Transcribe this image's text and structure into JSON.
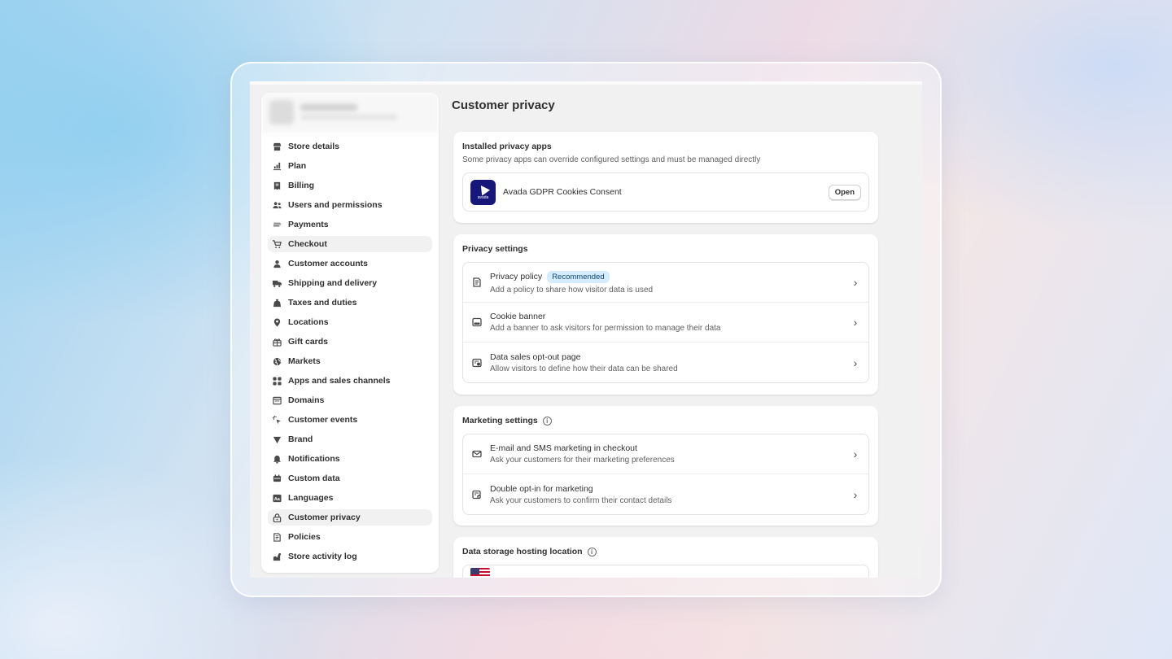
{
  "page": {
    "title": "Customer privacy"
  },
  "sidebar": {
    "items": [
      {
        "label": "Store details",
        "icon": "store-icon",
        "active": false
      },
      {
        "label": "Plan",
        "icon": "chart-icon",
        "active": false
      },
      {
        "label": "Billing",
        "icon": "receipt-icon",
        "active": false
      },
      {
        "label": "Users and permissions",
        "icon": "users-icon",
        "active": false
      },
      {
        "label": "Payments",
        "icon": "payments-icon",
        "active": false
      },
      {
        "label": "Checkout",
        "icon": "cart-icon",
        "active": true
      },
      {
        "label": "Customer accounts",
        "icon": "person-icon",
        "active": false
      },
      {
        "label": "Shipping and delivery",
        "icon": "truck-icon",
        "active": false
      },
      {
        "label": "Taxes and duties",
        "icon": "tax-icon",
        "active": false
      },
      {
        "label": "Locations",
        "icon": "location-icon",
        "active": false
      },
      {
        "label": "Gift cards",
        "icon": "gift-icon",
        "active": false
      },
      {
        "label": "Markets",
        "icon": "globe-icon",
        "active": false
      },
      {
        "label": "Apps and sales channels",
        "icon": "apps-icon",
        "active": false
      },
      {
        "label": "Domains",
        "icon": "domain-icon",
        "active": false
      },
      {
        "label": "Customer events",
        "icon": "cursor-icon",
        "active": false
      },
      {
        "label": "Brand",
        "icon": "brand-icon",
        "active": false
      },
      {
        "label": "Notifications",
        "icon": "bell-icon",
        "active": false
      },
      {
        "label": "Custom data",
        "icon": "database-icon",
        "active": false
      },
      {
        "label": "Languages",
        "icon": "language-icon",
        "active": false
      },
      {
        "label": "Customer privacy",
        "icon": "lock-icon",
        "active": true
      },
      {
        "label": "Policies",
        "icon": "policy-icon",
        "active": false
      },
      {
        "label": "Store activity log",
        "icon": "activity-icon",
        "active": false
      }
    ]
  },
  "installed_apps": {
    "title": "Installed privacy apps",
    "subtitle": "Some privacy apps can override configured settings and must be managed directly",
    "app": {
      "name": "Avada GDPR Cookies Consent",
      "logo_text": "avada",
      "button": "Open"
    }
  },
  "privacy_settings": {
    "title": "Privacy settings",
    "rows": [
      {
        "title": "Privacy policy",
        "badge": "Recommended",
        "desc": "Add a policy to share how visitor data is used",
        "icon": "policy-icon"
      },
      {
        "title": "Cookie banner",
        "badge": "",
        "desc": "Add a banner to ask visitors for permission to manage their data",
        "icon": "banner-icon"
      },
      {
        "title": "Data sales opt-out page",
        "badge": "",
        "desc": "Allow visitors to define how their data can be shared",
        "icon": "opt-out-icon"
      }
    ]
  },
  "marketing_settings": {
    "title": "Marketing settings",
    "rows": [
      {
        "title": "E-mail and SMS marketing in checkout",
        "desc": "Ask your customers for their marketing preferences",
        "icon": "email-icon"
      },
      {
        "title": "Double opt-in for marketing",
        "desc": "Ask your customers to confirm their contact details",
        "icon": "double-optin-icon"
      }
    ]
  },
  "data_storage": {
    "title": "Data storage hosting location"
  }
}
